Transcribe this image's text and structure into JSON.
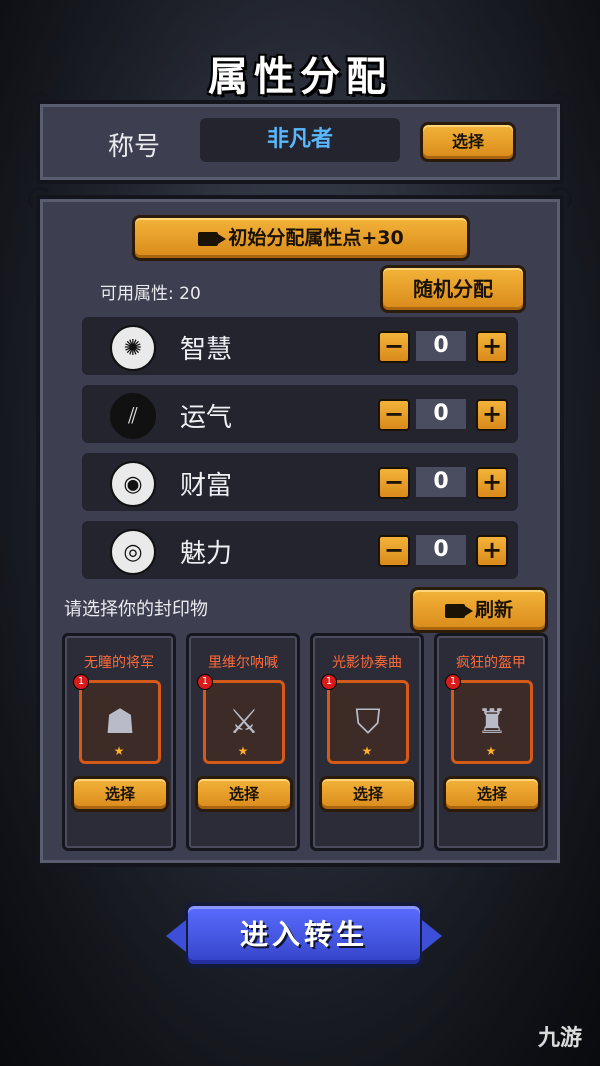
{
  "header": {
    "title": "属性分配"
  },
  "title_panel": {
    "label": "称号",
    "value": "非凡者",
    "select_label": "选择"
  },
  "attribute_panel": {
    "ad_button_label": "初始分配属性点+30",
    "available_label": "可用属性: 20",
    "random_button_label": "随机分配",
    "attributes": [
      {
        "name": "智慧",
        "value": "0",
        "icon": "brain-icon"
      },
      {
        "name": "运气",
        "value": "0",
        "icon": "claw-slash-icon"
      },
      {
        "name": "财富",
        "value": "0",
        "icon": "coin-icon"
      },
      {
        "name": "魅力",
        "value": "0",
        "icon": "eye-icon"
      }
    ],
    "minus": "−",
    "plus": "+"
  },
  "seal_section": {
    "label": "请选择你的封印物",
    "refresh_label": "刷新",
    "cards": [
      {
        "name": "无瞳的将军",
        "level": "1",
        "select_label": "选择",
        "icon": "mask-icon"
      },
      {
        "name": "里维尔呐喊",
        "level": "1",
        "select_label": "选择",
        "icon": "blade-icon"
      },
      {
        "name": "光影协奏曲",
        "level": "1",
        "select_label": "选择",
        "icon": "shield-icon"
      },
      {
        "name": "疯狂的盔甲",
        "level": "1",
        "select_label": "选择",
        "icon": "armor-icon"
      }
    ]
  },
  "footer": {
    "enter_label": "进入转生",
    "watermark": "九游"
  },
  "colors": {
    "gold": "#f3b33a",
    "blue_button": "#3d4fd8",
    "title_value": "#59b8ff",
    "card_name": "#ff6a3a"
  }
}
